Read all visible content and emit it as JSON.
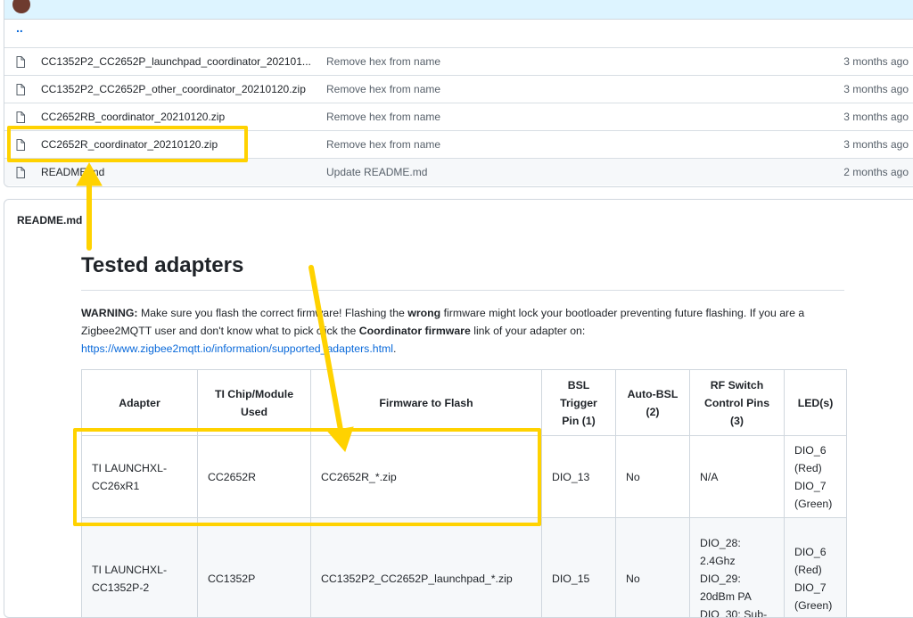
{
  "files": {
    "parent_dir": "..",
    "rows": [
      {
        "name": "CC1352P2_CC2652P_launchpad_coordinator_202101...",
        "message": "Remove hex from name",
        "age": "3 months ago"
      },
      {
        "name": "CC1352P2_CC2652P_other_coordinator_20210120.zip",
        "message": "Remove hex from name",
        "age": "3 months ago"
      },
      {
        "name": "CC2652RB_coordinator_20210120.zip",
        "message": "Remove hex from name",
        "age": "3 months ago"
      },
      {
        "name": "CC2652R_coordinator_20210120.zip",
        "message": "Remove hex from name",
        "age": "3 months ago"
      },
      {
        "name": "README.md",
        "message": "Update README.md",
        "age": "2 months ago"
      }
    ]
  },
  "readme": {
    "label": "README.md",
    "title": "Tested adapters",
    "warning_prefix": "WARNING:",
    "warning_1": " Make sure you flash the correct firmware! Flashing the ",
    "warning_wrong": "wrong",
    "warning_2": " firmware might lock your bootloader preventing future flashing. If you are a Zigbee2MQTT user and don't know what to pick click the ",
    "warning_coord": "Coordinator firmware",
    "warning_3": " link of your adapter on: ",
    "warning_link": "https://www.zigbee2mqtt.io/information/supported_adapters.html",
    "warning_end": "."
  },
  "table": {
    "headers": {
      "adapter": "Adapter",
      "chip_1": "TI Chip/Module",
      "chip_2": "Used",
      "firmware": "Firmware to Flash",
      "bsl_1": "BSL",
      "bsl_2": "Trigger",
      "bsl_3": "Pin (1)",
      "auto_1": "Auto-BSL",
      "auto_2": "(2)",
      "rf_1": "RF Switch",
      "rf_2": "Control Pins",
      "rf_3": "(3)",
      "led": "LED(s)"
    },
    "rows": [
      {
        "adapter_1": "TI LAUNCHXL-",
        "adapter_2": "CC26xR1",
        "chip": "CC2652R",
        "firmware": "CC2652R_*.zip",
        "bsl": "DIO_13",
        "auto": "No",
        "rf_1": "N/A",
        "led_1": "DIO_6",
        "led_2": "(Red)",
        "led_3": "DIO_7",
        "led_4": "(Green)"
      },
      {
        "adapter_1": "TI LAUNCHXL-",
        "adapter_2": "CC1352P-2",
        "chip": "CC1352P",
        "firmware": "CC1352P2_CC2652P_launchpad_*.zip",
        "bsl": "DIO_15",
        "auto": "No",
        "rf_1": "DIO_28:",
        "rf_2": "2.4Ghz",
        "rf_3": "DIO_29:",
        "rf_4": "20dBm PA",
        "rf_5": "DIO_30: Sub-",
        "led_1": "DIO_6",
        "led_2": "(Red)",
        "led_3": "DIO_7",
        "led_4": "(Green)"
      }
    ]
  },
  "annotation_color": "#ffd200"
}
